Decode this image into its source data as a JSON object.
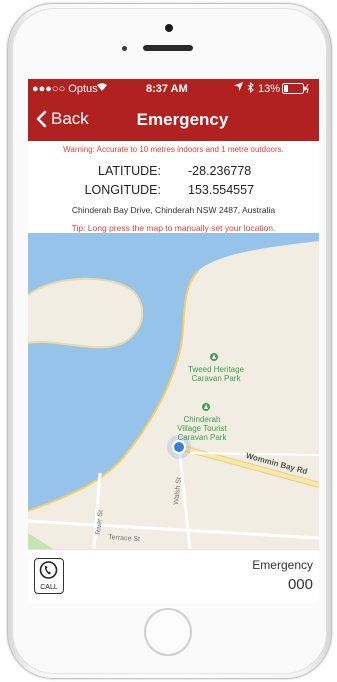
{
  "status_bar": {
    "carrier": "●●●○○ Optus",
    "time": "8:37 AM",
    "battery": "13%"
  },
  "nav": {
    "back_label": "Back",
    "title": "Emergency"
  },
  "info": {
    "warning": "Warning: Accurate to 10 metres indoors and 1 metre outdoors.",
    "latitude_label": "LATITUDE:",
    "latitude_value": "-28.236778",
    "longitude_label": "LONGITUDE:",
    "longitude_value": "153.554557",
    "address": "Chinderah Bay Drive, Chinderah NSW 2487, Australia",
    "tip": "Tip: Long press the map to manually set your location."
  },
  "map": {
    "poi_1": [
      "Tweed Heritage",
      "Caravan Park"
    ],
    "poi_2": [
      "Chinderah",
      "Village Tourist",
      "Caravan Park"
    ],
    "road_wommin": "Wommin Bay Rd",
    "road_walsh": "Walsh St",
    "road_river": "River St",
    "road_terrace": "Terrace St",
    "colors": {
      "water": "#96c3ea",
      "land": "#f1ede3",
      "road": "#fbe7a6",
      "poi": "#3fa14d",
      "location": "#3b7ddb"
    }
  },
  "bottom": {
    "call_label": "CALL",
    "service_label": "Emergency",
    "service_number": "000"
  },
  "icons": [
    "back-chevron-icon",
    "wifi-icon",
    "location-arrow-icon",
    "bluetooth-icon",
    "battery-icon",
    "phone-icon",
    "poi-marker-icon"
  ]
}
